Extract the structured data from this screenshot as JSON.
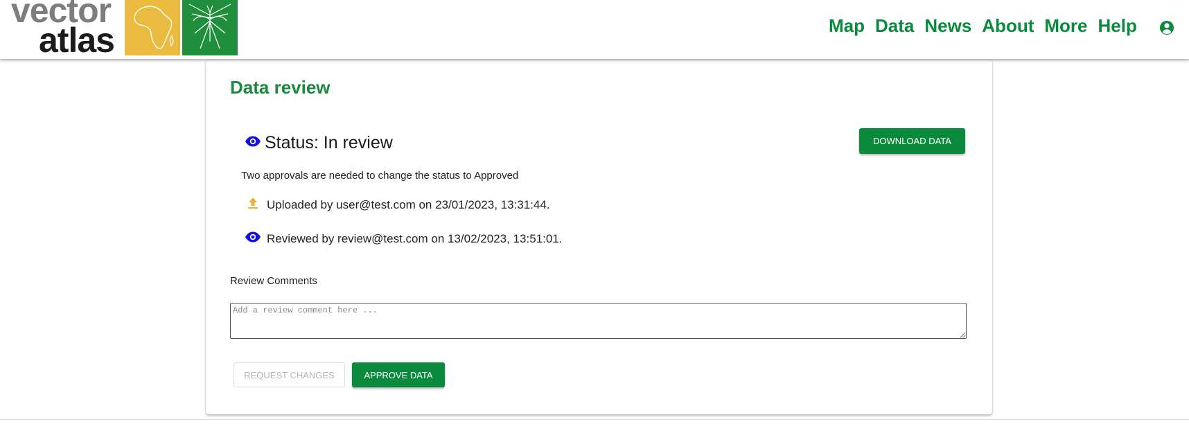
{
  "header": {
    "logo": {
      "word1": "vector",
      "word2": "atlas"
    },
    "nav": [
      "Map",
      "Data",
      "News",
      "About",
      "More",
      "Help"
    ],
    "account_icon": "account-circle-icon",
    "colors": {
      "nav": "#0a8a3c",
      "africa_tile": "#ebbb3f",
      "mosquito_tile": "#1f8f3c"
    }
  },
  "review": {
    "title": "Data review",
    "status_icon": "eye-icon",
    "status": "Status: In review",
    "download_label": "DOWNLOAD DATA",
    "approvals_note": "Two approvals are needed to change the status to Approved",
    "events": [
      {
        "icon": "upload-icon",
        "text": "Uploaded by user@test.com on 23/01/2023, 13:31:44."
      },
      {
        "icon": "eye-icon",
        "text": "Reviewed by review@test.com on 13/02/2023, 13:51:01."
      }
    ],
    "comments_label": "Review Comments",
    "comment_placeholder": "Add a review comment here ...",
    "request_changes_label": "REQUEST CHANGES",
    "approve_label": "APPROVE DATA",
    "colors": {
      "title": "#1b8a3d",
      "eye": "#1010e0",
      "upload": "#e8b23a",
      "button": "#0a8a3c"
    }
  }
}
